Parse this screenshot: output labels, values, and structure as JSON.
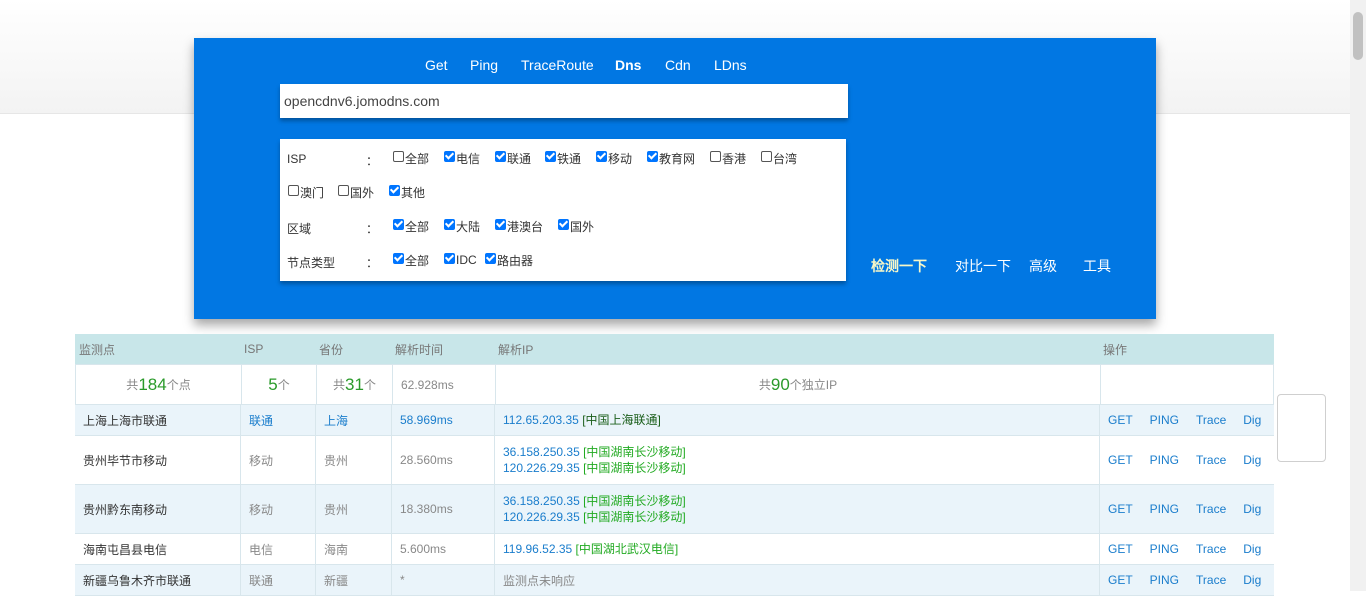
{
  "nav": {
    "tabs": [
      {
        "label": "Get",
        "active": false
      },
      {
        "label": "Ping",
        "active": false
      },
      {
        "label": "TraceRoute",
        "active": false
      },
      {
        "label": "Dns",
        "active": true
      },
      {
        "label": "Cdn",
        "active": false
      },
      {
        "label": "LDns",
        "active": false
      }
    ]
  },
  "search": {
    "value": "opencdnv6.jomodns.com"
  },
  "filters": {
    "isp": {
      "label": "ISP",
      "colon": "：",
      "options": [
        {
          "label": "全部",
          "checked": false
        },
        {
          "label": "电信",
          "checked": true
        },
        {
          "label": "联通",
          "checked": true
        },
        {
          "label": "铁通",
          "checked": true
        },
        {
          "label": "移动",
          "checked": true
        },
        {
          "label": "教育网",
          "checked": true
        },
        {
          "label": "香港",
          "checked": false
        },
        {
          "label": "台湾",
          "checked": false
        },
        {
          "label": "澳门",
          "checked": false
        },
        {
          "label": "国外",
          "checked": false
        },
        {
          "label": "其他",
          "checked": true
        }
      ]
    },
    "region": {
      "label": "区域",
      "colon": "：",
      "options": [
        {
          "label": "全部",
          "checked": true
        },
        {
          "label": "大陆",
          "checked": true
        },
        {
          "label": "港澳台",
          "checked": true
        },
        {
          "label": "国外",
          "checked": true
        }
      ]
    },
    "node_type": {
      "label": "节点类型",
      "colon": "：",
      "options": [
        {
          "label": "全部",
          "checked": true
        },
        {
          "label": "IDC",
          "checked": true
        },
        {
          "label": "路由器",
          "checked": true
        }
      ]
    }
  },
  "actions": {
    "detect": "检测一下",
    "compare": "对比一下",
    "advanced": "高级",
    "tools": "工具"
  },
  "table": {
    "headers": {
      "monitor": "监测点",
      "isp": "ISP",
      "province": "省份",
      "resolve_time": "解析时间",
      "resolve_ip": "解析IP",
      "ops": "操作"
    },
    "summary": {
      "points_prefix": "共",
      "points_count": "184",
      "points_suffix": "个点",
      "isp_count": "5",
      "isp_suffix": "个",
      "prov_prefix": "共",
      "prov_count": "31",
      "prov_suffix": "个",
      "time": "62.928ms",
      "ip_prefix": "共",
      "ip_count": "90",
      "ip_suffix": "个独立IP"
    },
    "op_labels": {
      "get": "GET",
      "ping": "PING",
      "trace": "Trace",
      "dig": "Dig"
    },
    "rows": [
      {
        "monitor": "上海上海市联通",
        "isp": "联通",
        "province": "上海",
        "time": "58.969ms",
        "ips": [
          {
            "addr": "112.65.203.35",
            "loc": "[中国上海联通]"
          }
        ]
      },
      {
        "monitor": "贵州毕节市移动",
        "isp": "移动",
        "province": "贵州",
        "time": "28.560ms",
        "ips": [
          {
            "addr": "36.158.250.35",
            "loc": "[中国湖南长沙移动]"
          },
          {
            "addr": "120.226.29.35",
            "loc": "[中国湖南长沙移动]"
          }
        ]
      },
      {
        "monitor": "贵州黔东南移动",
        "isp": "移动",
        "province": "贵州",
        "time": "18.380ms",
        "ips": [
          {
            "addr": "36.158.250.35",
            "loc": "[中国湖南长沙移动]"
          },
          {
            "addr": "120.226.29.35",
            "loc": "[中国湖南长沙移动]"
          }
        ]
      },
      {
        "monitor": "海南屯昌县电信",
        "isp": "电信",
        "province": "海南",
        "time": "5.600ms",
        "ips": [
          {
            "addr": "119.96.52.35",
            "loc": "[中国湖北武汉电信]"
          }
        ]
      },
      {
        "monitor": "新疆乌鲁木齐市联通",
        "isp": "联通",
        "province": "新疆",
        "time": "*",
        "no_response": "监测点未响应"
      }
    ]
  }
}
